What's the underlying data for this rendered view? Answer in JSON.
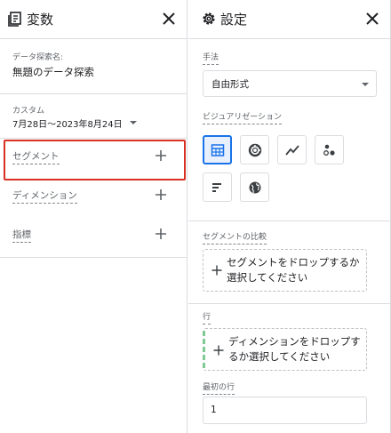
{
  "variables": {
    "title": "変数",
    "exploration_name_label": "データ探索名:",
    "exploration_name": "無題のデータ探索",
    "date_custom_label": "カスタム",
    "date_range": "7月28日～2023年8月24日",
    "segment_label": "セグメント",
    "dimension_label": "ディメンション",
    "metric_label": "指標"
  },
  "settings": {
    "title": "設定",
    "technique_label": "手法",
    "technique_value": "自由形式",
    "visualization_label": "ビジュアリゼーション",
    "visualization_options": [
      "table-icon",
      "donut-chart-icon",
      "line-chart-icon",
      "scatter-icon",
      "bar-chart-icon",
      "globe-icon"
    ],
    "segment_compare_label": "セグメントの比較",
    "segment_drop_text": "セグメントをドロップするか選択してください",
    "rows_label": "行",
    "dimension_drop_text": "ディメンションをドロップするか選択してください",
    "first_row_label": "最初の行",
    "first_row_value": "1"
  },
  "colors": {
    "accent": "#1a73e8",
    "highlight": "#d93025",
    "row_indicator": "#81c995"
  }
}
